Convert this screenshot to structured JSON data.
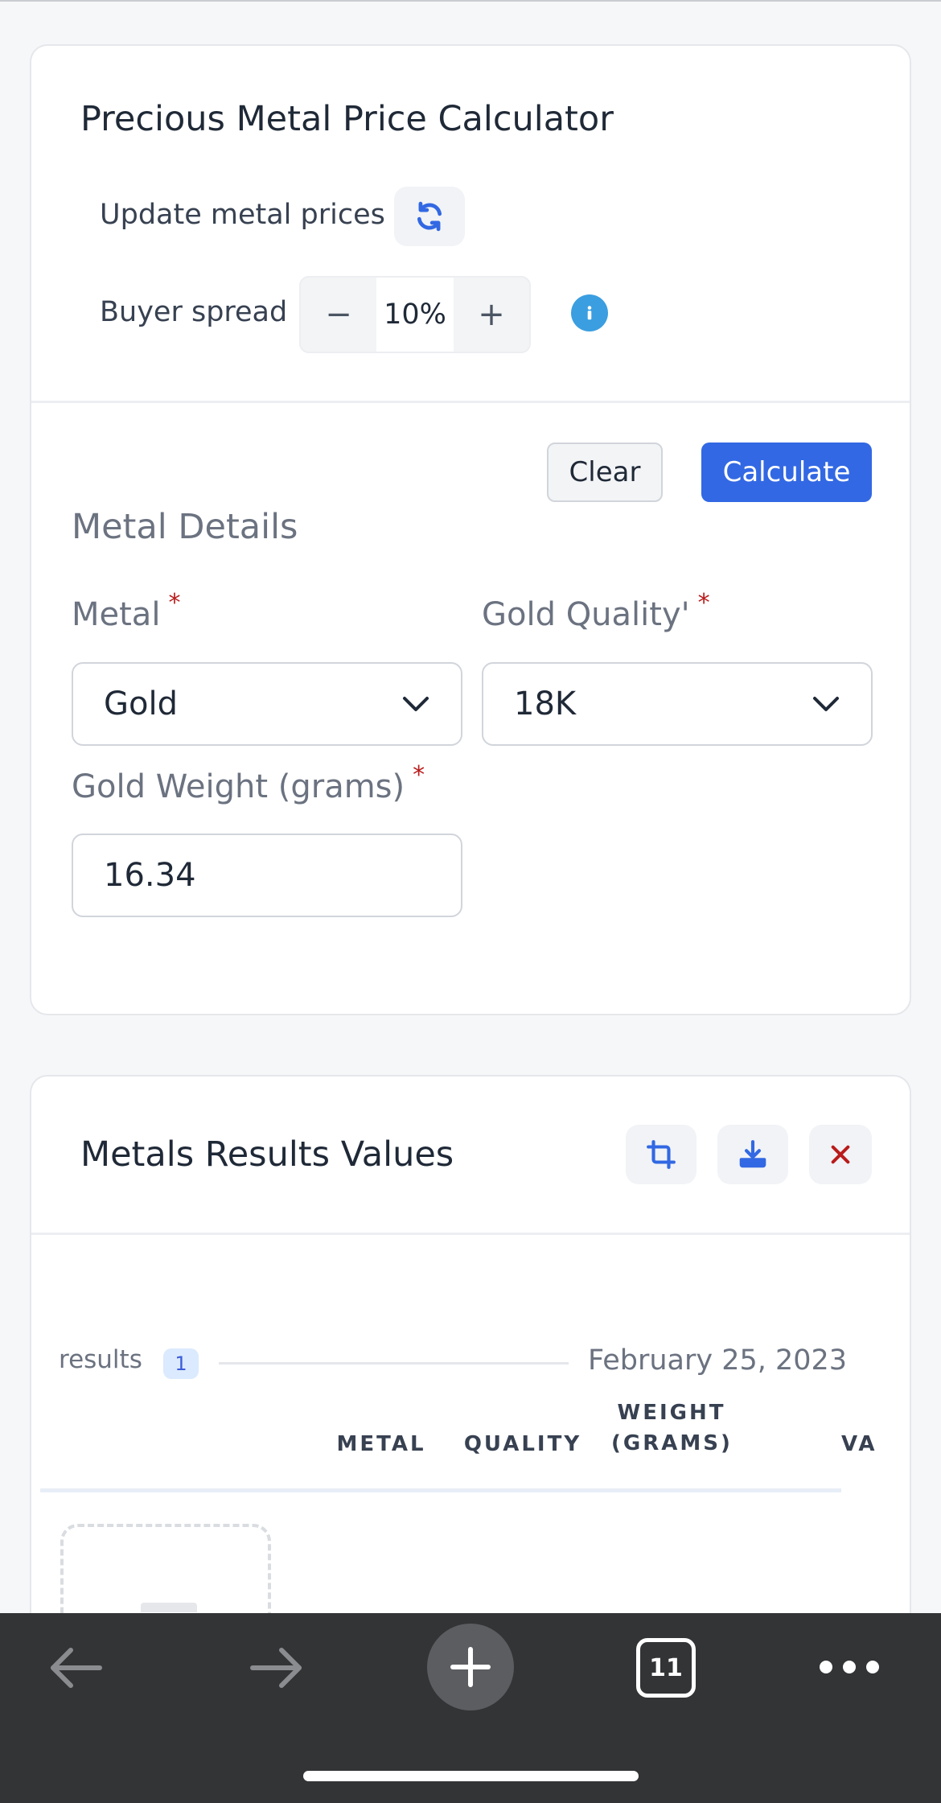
{
  "calculator": {
    "title": "Precious Metal Price Calculator",
    "update_label": "Update metal prices",
    "spread_label": "Buyer spread",
    "spread_minus": "−",
    "spread_value": "10%",
    "spread_plus": "+",
    "clear_label": "Clear",
    "calculate_label": "Calculate",
    "section_title": "Metal Details",
    "metal_label": "Metal",
    "metal_value": "Gold",
    "quality_label": "Gold Quality'",
    "quality_value": "18K",
    "weight_label": "Gold Weight (grams)",
    "weight_value": "16.34",
    "required_mark": "*"
  },
  "results": {
    "title": "Metals Results Values",
    "results_label": "results",
    "count": "1",
    "date": "February 25, 2023",
    "columns": {
      "metal": "METAL",
      "quality": "QUALITY",
      "weight_line1": "WEIGHT",
      "weight_line2": "(GRAMS)",
      "value": "VA"
    }
  },
  "browser": {
    "tab_count": "11"
  },
  "colors": {
    "accent": "#3268e3",
    "info": "#3b9ee0",
    "danger": "#b91c1c"
  },
  "icons": [
    "refresh-icon",
    "info-icon",
    "chevron-down-icon",
    "crop-icon",
    "download-icon",
    "close-icon",
    "back-arrow-icon",
    "forward-arrow-icon",
    "plus-icon",
    "tabs-icon",
    "more-icon"
  ]
}
